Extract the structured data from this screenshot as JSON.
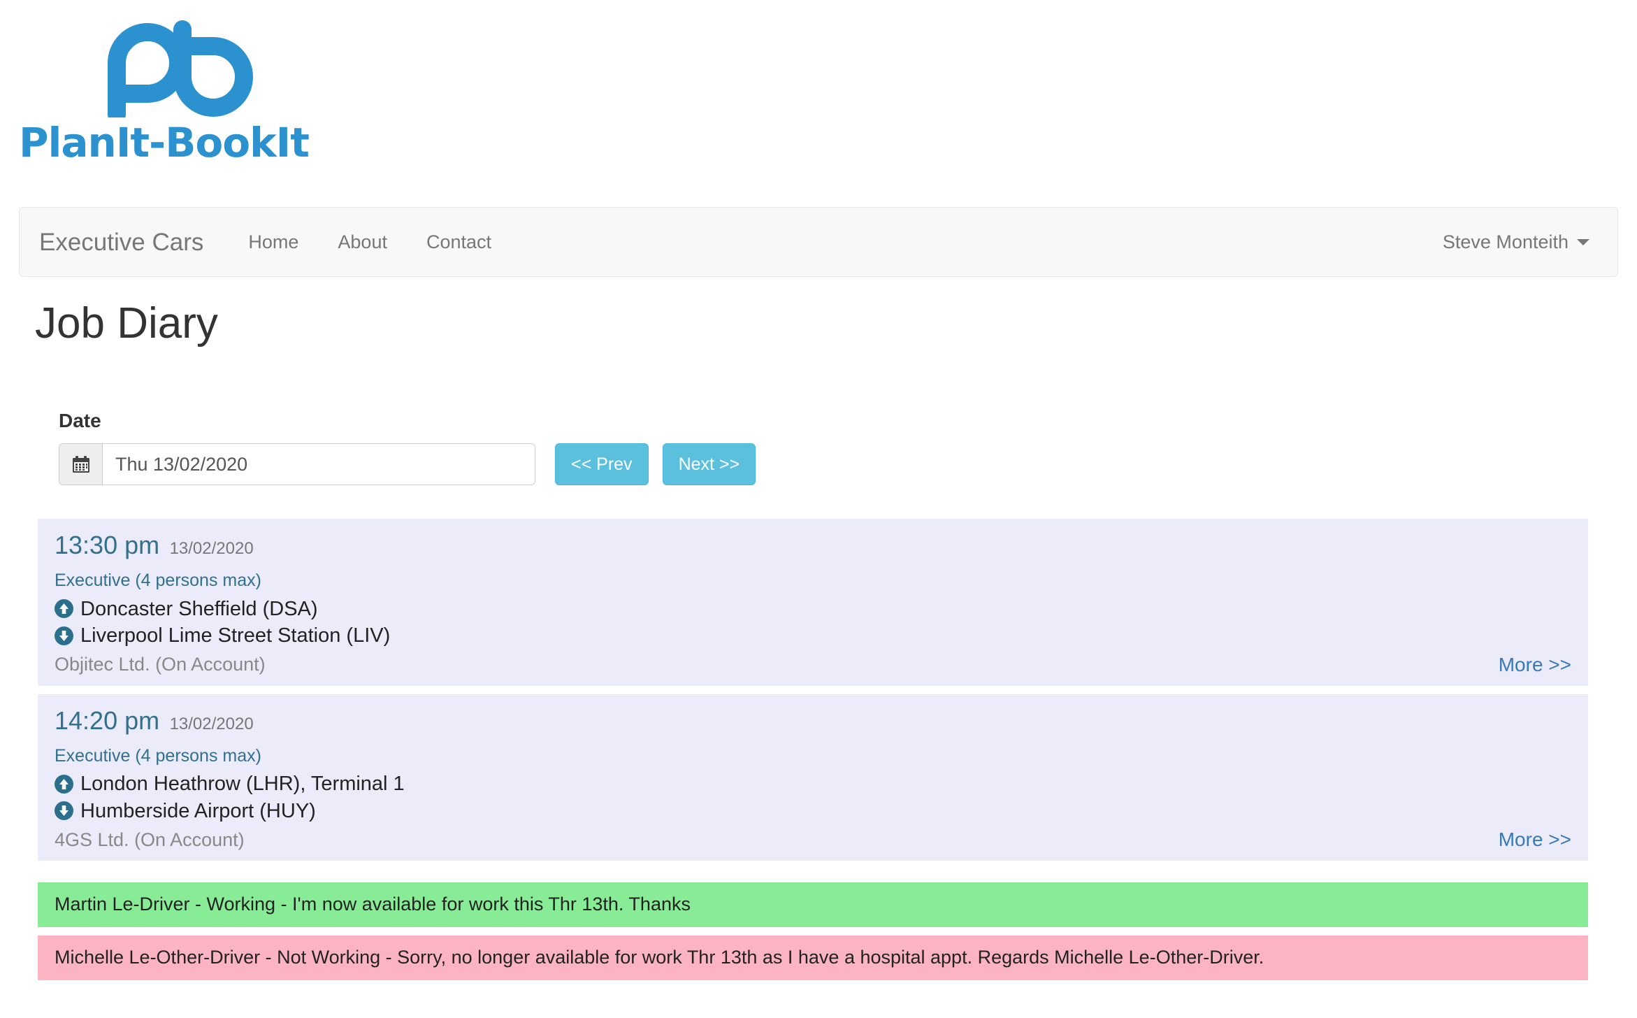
{
  "brand": {
    "logo_text": "PlanIt-BookIt",
    "logo_color": "#2b91cf"
  },
  "navbar": {
    "brand": "Executive Cars",
    "links": [
      {
        "label": "Home"
      },
      {
        "label": "About"
      },
      {
        "label": "Contact"
      }
    ],
    "user": "Steve Monteith"
  },
  "page": {
    "title": "Job Diary"
  },
  "date_filter": {
    "label": "Date",
    "value": "Thu 13/02/2020",
    "placeholder": "Thu 13/02/2020",
    "calendar_icon": "calendar-icon",
    "prev_label": "<< Prev",
    "next_label": "Next >>"
  },
  "jobs": [
    {
      "time": "13:30 pm",
      "date": "13/02/2020",
      "vehicle": "Executive (4 persons max)",
      "pickup": "Doncaster Sheffield (DSA)",
      "dropoff": "Liverpool Lime Street Station (LIV)",
      "client": "Objitec Ltd. (On Account)",
      "more_label": "More >>"
    },
    {
      "time": "14:20 pm",
      "date": "13/02/2020",
      "vehicle": "Executive (4 persons max)",
      "pickup": "London Heathrow (LHR), Terminal 1",
      "dropoff": "Humberside Airport (HUY)",
      "client": "4GS Ltd. (On Account)",
      "more_label": "More >>"
    }
  ],
  "driver_alerts": [
    {
      "status": "working",
      "text": "Martin Le-Driver - Working - I'm now available for work this Thr 13th. Thanks",
      "color": "#88ec96"
    },
    {
      "status": "not-working",
      "text": "Michelle Le-Other-Driver - Not Working - Sorry, no longer available for work Thr 13th as I have a hospital appt. Regards Michelle Le-Other-Driver.",
      "color": "#fcb4c3"
    }
  ],
  "colors": {
    "accent": "#2b91cf",
    "info_button": "#5bc0de",
    "card_background": "#ecebf9",
    "link": "#3879b9",
    "muted": "#777777"
  }
}
